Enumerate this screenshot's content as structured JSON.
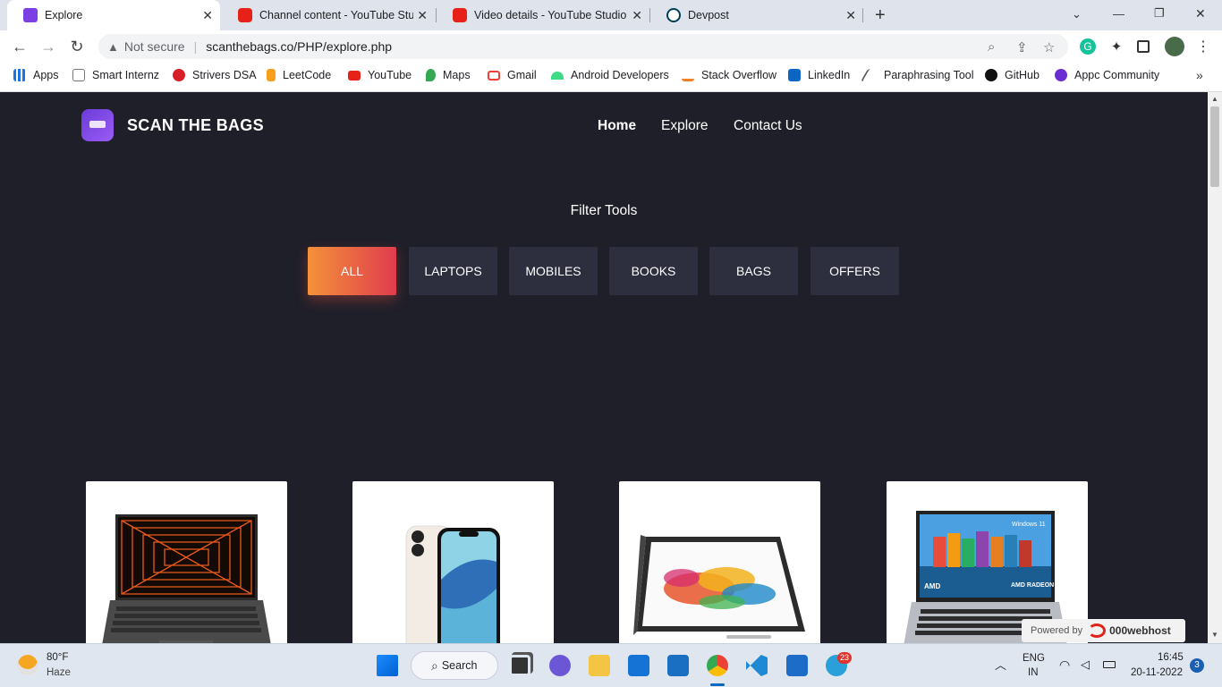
{
  "tabs": [
    {
      "label": "Explore",
      "active": true
    },
    {
      "label": "Channel content - YouTube Studio",
      "active": false
    },
    {
      "label": "Video details - YouTube Studio",
      "active": false
    },
    {
      "label": "Devpost",
      "active": false
    }
  ],
  "omnibox": {
    "security": "Not secure",
    "url": "scanthebags.co/PHP/explore.php"
  },
  "bookmarks": [
    "Apps",
    "Smart Internz",
    "Strivers DSA",
    "LeetCode",
    "YouTube",
    "Maps",
    "Gmail",
    "Android Developers",
    "Stack Overflow",
    "LinkedIn",
    "Paraphrasing Tool",
    "GitHub",
    "Appc Community"
  ],
  "site": {
    "brand": "SCAN THE BAGS",
    "nav": [
      "Home",
      "Explore",
      "Contact Us"
    ],
    "filter_title": "Filter Tools",
    "filters": [
      "ALL",
      "LAPTOPS",
      "MOBILES",
      "BOOKS",
      "BAGS",
      "OFFERS"
    ],
    "active_filter": "ALL",
    "products": [
      "laptop-dark",
      "iphone",
      "convertible-laptop",
      "acer-laptop"
    ],
    "card3_text": {
      "screen_badge": "Windows 11",
      "amd": "AMD",
      "radeon": "AMD RADEON"
    }
  },
  "watermark": {
    "powered": "Powered by",
    "host": "000webhost"
  },
  "taskbar": {
    "temp": "80°F",
    "weather": "Haze",
    "search": "Search",
    "lang1": "ENG",
    "lang2": "IN",
    "time": "16:45",
    "date": "20-11-2022",
    "notif": "3",
    "telegram_badge": "23"
  },
  "colors": {
    "accent_start": "#f4913a",
    "accent_end": "#e03c4d",
    "page_bg": "#1f1f29",
    "button_bg": "#2e2f3e"
  }
}
